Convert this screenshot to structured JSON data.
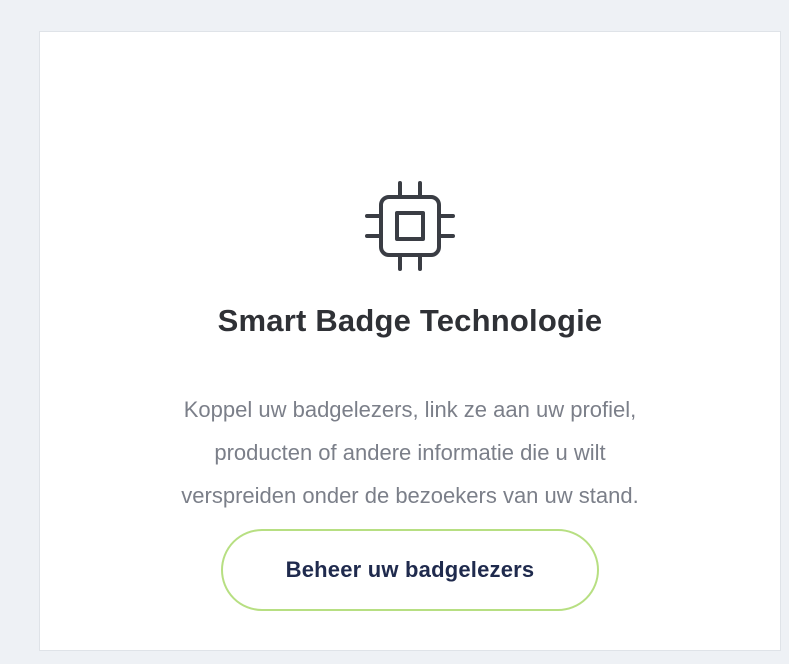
{
  "card": {
    "icon": "chip-icon",
    "title": "Smart Badge Technologie",
    "description_lines": [
      "Koppel uw badgelezers, link ze aan uw profiel,",
      "producten of andere informatie die u wilt",
      "verspreiden onder de bezoekers van uw stand."
    ],
    "button_label": "Beheer uw badgelezers"
  },
  "colors": {
    "page_bg": "#eef1f5",
    "card_bg": "#ffffff",
    "card_border": "#dfe3e8",
    "title": "#2f3136",
    "description": "#7b7f89",
    "button_border": "#b7df82",
    "button_text": "#1f2a4d",
    "icon_stroke": "#3a3d44"
  }
}
